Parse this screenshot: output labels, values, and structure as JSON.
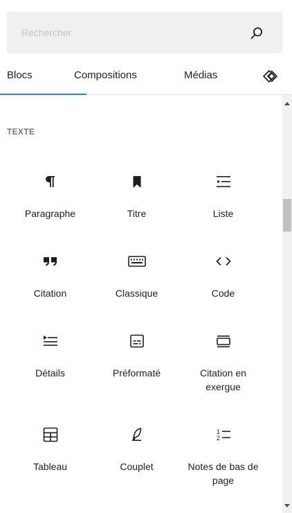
{
  "search": {
    "placeholder": "Rechercher",
    "value": "",
    "icon": "search-icon"
  },
  "tabs": [
    {
      "label": "Blocs",
      "active": true
    },
    {
      "label": "Compositions",
      "active": false
    },
    {
      "label": "Médias",
      "active": false
    }
  ],
  "patterns_icon": "block-patterns-icon",
  "category": {
    "title": "TEXTE",
    "blocks": [
      {
        "label": "Paragraphe",
        "icon": "paragraph-icon"
      },
      {
        "label": "Titre",
        "icon": "bookmark-icon"
      },
      {
        "label": "Liste",
        "icon": "list-icon"
      },
      {
        "label": "Citation",
        "icon": "quote-icon"
      },
      {
        "label": "Classique",
        "icon": "keyboard-icon"
      },
      {
        "label": "Code",
        "icon": "code-icon"
      },
      {
        "label": "Détails",
        "icon": "details-icon"
      },
      {
        "label": "Préformaté",
        "icon": "preformatted-icon"
      },
      {
        "label": "Citation en exergue",
        "icon": "pullquote-icon"
      },
      {
        "label": "Tableau",
        "icon": "table-icon"
      },
      {
        "label": "Couplet",
        "icon": "verse-icon"
      },
      {
        "label": "Notes de bas de page",
        "icon": "footnotes-icon"
      }
    ]
  },
  "accent_color": "#3582c4"
}
